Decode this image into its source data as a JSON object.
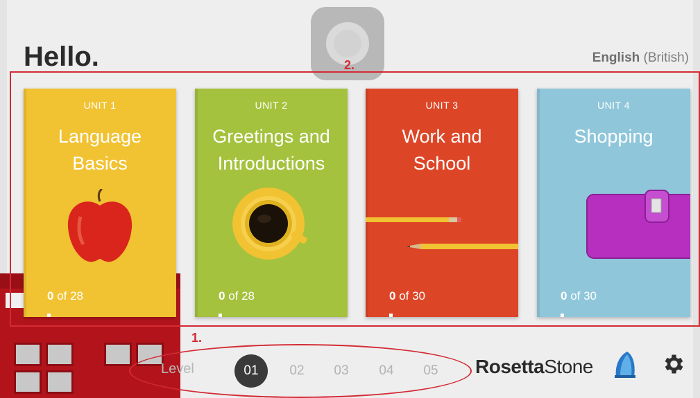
{
  "header": {
    "greeting": "Hello.",
    "language_main": "English",
    "language_variant": "(British)"
  },
  "annotations": {
    "label_1": "1.",
    "label_2": "2."
  },
  "units": [
    {
      "unit_label": "UNIT 1",
      "title_line1": "Language",
      "title_line2": "Basics",
      "progress_done": "0",
      "progress_total": "of 28",
      "color": "#f1c232",
      "image": "apple-icon"
    },
    {
      "unit_label": "UNIT 2",
      "title_line1": "Greetings and",
      "title_line2": "Introductions",
      "progress_done": "0",
      "progress_total": "of 28",
      "color": "#a4c23d",
      "image": "coffee-cup-icon"
    },
    {
      "unit_label": "UNIT 3",
      "title_line1": "Work and",
      "title_line2": "School",
      "progress_done": "0",
      "progress_total": "of 30",
      "color": "#dd4527",
      "image": "pencils-icon"
    },
    {
      "unit_label": "UNIT 4",
      "title_line1": "Shopping",
      "title_line2": "",
      "progress_done": "0",
      "progress_total": "of 30",
      "color": "#8fc6da",
      "image": "wallet-icon"
    }
  ],
  "levels": {
    "label": "Level",
    "items": [
      "01",
      "02",
      "03",
      "04",
      "05"
    ],
    "selected": "01"
  },
  "footer": {
    "brand_bold": "Rosetta",
    "brand_regular": "Stone"
  }
}
